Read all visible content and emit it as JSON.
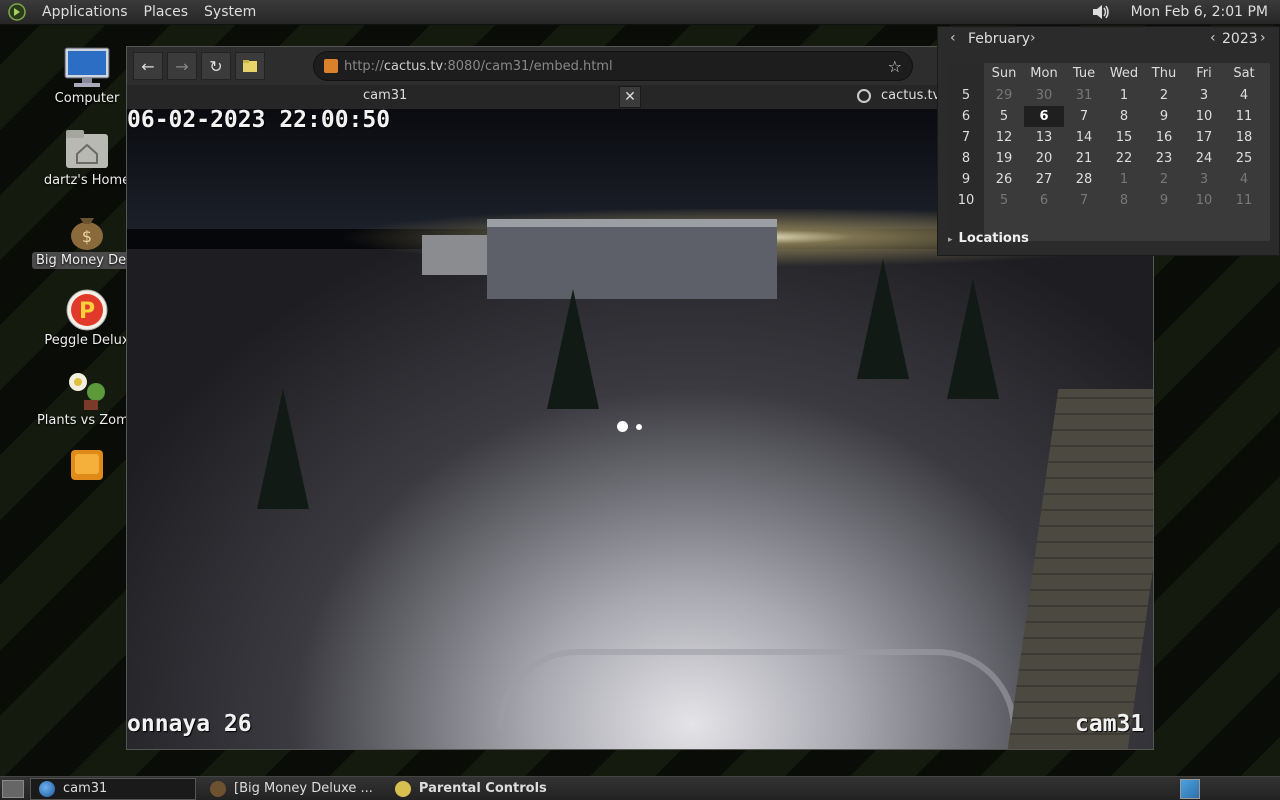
{
  "top_panel": {
    "menus": [
      "Applications",
      "Places",
      "System"
    ],
    "clock": "Mon Feb  6,  2:01 PM"
  },
  "desktop": {
    "icons": [
      {
        "label": "Computer",
        "icon": "computer-icon"
      },
      {
        "label": "dartz's Home",
        "icon": "home-folder-icon"
      },
      {
        "label": "Big Money Delu",
        "icon": "money-bag-icon",
        "selected": true
      },
      {
        "label": "Peggle Delux",
        "icon": "peggle-icon"
      },
      {
        "label": "Plants vs Zomb",
        "icon": "plants-icon"
      },
      {
        "label": "",
        "icon": "game-icon"
      }
    ]
  },
  "browser": {
    "url_prefix": "http://",
    "url_host": "cactus.tv",
    "url_rest": ":8080/cam31/embed.html",
    "tab_title": "cam31",
    "tab_close": "✕",
    "second_tab": "cactus.tv",
    "video": {
      "timestamp": "06-02-2023 22:00:50",
      "location_text": "onnaya 26",
      "camera_name": "cam31"
    }
  },
  "calendar": {
    "month": "February",
    "year": "2023",
    "weekday_headers": [
      "Sun",
      "Mon",
      "Tue",
      "Wed",
      "Thu",
      "Fri",
      "Sat"
    ],
    "weeks": [
      {
        "week": "5",
        "days": [
          "29",
          "30",
          "31",
          "1",
          "2",
          "3",
          "4"
        ],
        "other": [
          true,
          true,
          true,
          false,
          false,
          false,
          false
        ]
      },
      {
        "week": "6",
        "days": [
          "5",
          "6",
          "7",
          "8",
          "9",
          "10",
          "11"
        ],
        "other": [
          false,
          false,
          false,
          false,
          false,
          false,
          false
        ]
      },
      {
        "week": "7",
        "days": [
          "12",
          "13",
          "14",
          "15",
          "16",
          "17",
          "18"
        ],
        "other": [
          false,
          false,
          false,
          false,
          false,
          false,
          false
        ]
      },
      {
        "week": "8",
        "days": [
          "19",
          "20",
          "21",
          "22",
          "23",
          "24",
          "25"
        ],
        "other": [
          false,
          false,
          false,
          false,
          false,
          false,
          false
        ]
      },
      {
        "week": "9",
        "days": [
          "26",
          "27",
          "28",
          "1",
          "2",
          "3",
          "4"
        ],
        "other": [
          false,
          false,
          false,
          true,
          true,
          true,
          true
        ]
      },
      {
        "week": "10",
        "days": [
          "5",
          "6",
          "7",
          "8",
          "9",
          "10",
          "11"
        ],
        "other": [
          true,
          true,
          true,
          true,
          true,
          true,
          true
        ]
      }
    ],
    "today": "6",
    "locations_label": "Locations"
  },
  "taskbar": {
    "tasks": [
      {
        "label": "cam31",
        "active": true
      },
      {
        "label": "[Big Money Deluxe ...",
        "active": false
      },
      {
        "label": "Parental Controls",
        "active": false,
        "bold": true
      }
    ]
  }
}
